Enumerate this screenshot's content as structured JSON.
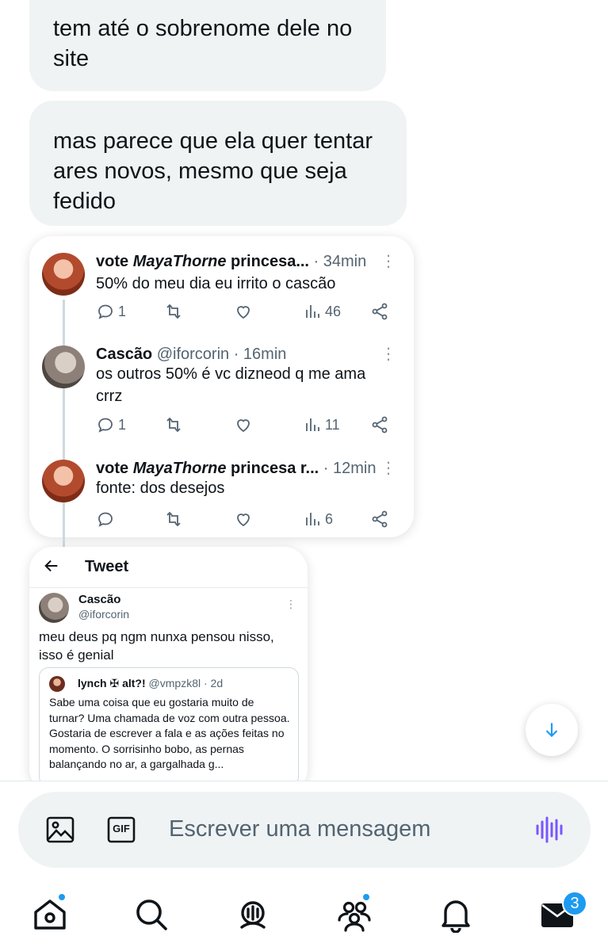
{
  "messages": [
    {
      "text": "tem até o sobrenome dele no site"
    },
    {
      "text": "mas parece que ela quer tentar ares novos, mesmo que seja fedido"
    }
  ],
  "thread": {
    "tweets": [
      {
        "name_prefix": "vote ",
        "name_italic": "MayaThorne",
        "name_suffix": " princesa...",
        "meta": " · 34min",
        "text": "50% do meu dia eu irrito o cascão",
        "replies": "1",
        "retweets": "",
        "likes": "",
        "views": "46"
      },
      {
        "name_prefix": "Cascão",
        "name_italic": "",
        "name_suffix": "",
        "meta": " @iforcorin · 16min",
        "text": "os outros 50% é vc dizneod q me ama crrz",
        "replies": "1",
        "retweets": "",
        "likes": "",
        "views": "11"
      },
      {
        "name_prefix": "vote ",
        "name_italic": "MayaThorne",
        "name_suffix": " princesa r...",
        "meta": " · 12min",
        "text": "fonte: dos desejos",
        "replies": "",
        "retweets": "",
        "likes": "",
        "views": "6"
      }
    ]
  },
  "tweet_screenshot": {
    "header_title": "Tweet",
    "author_name": "Cascão",
    "author_handle": "@iforcorin",
    "text": "meu deus pq ngm nunxa pensou nisso, isso é genial",
    "quote": {
      "name": "lynch ✠ alt?!",
      "handle_time": "@vmpzk8l · 2d",
      "text": "Sabe uma coisa que eu gostaria muito de turnar? Uma chamada de voz com outra pessoa. Gostaria de escrever a fala e as ações feitas no momento. O sorrisinho bobo, as pernas balançando no ar, a gargalhada g..."
    }
  },
  "composer": {
    "placeholder": "Escrever uma mensagem",
    "gif_label": "GIF"
  },
  "tabbar": {
    "messages_badge": "3"
  },
  "colors": {
    "accent": "#1d9bf0",
    "bubble": "#eff3f4",
    "voice": "#7856ff",
    "secondary_text": "#536471"
  },
  "icons": [
    "image-icon",
    "gif-icon",
    "voice-icon",
    "home-icon",
    "search-icon",
    "spaces-icon",
    "communities-icon",
    "notifications-icon",
    "messages-icon",
    "arrow-down-icon",
    "back-arrow-icon",
    "reply-icon",
    "retweet-icon",
    "like-icon",
    "views-icon",
    "share-icon",
    "more-icon"
  ]
}
